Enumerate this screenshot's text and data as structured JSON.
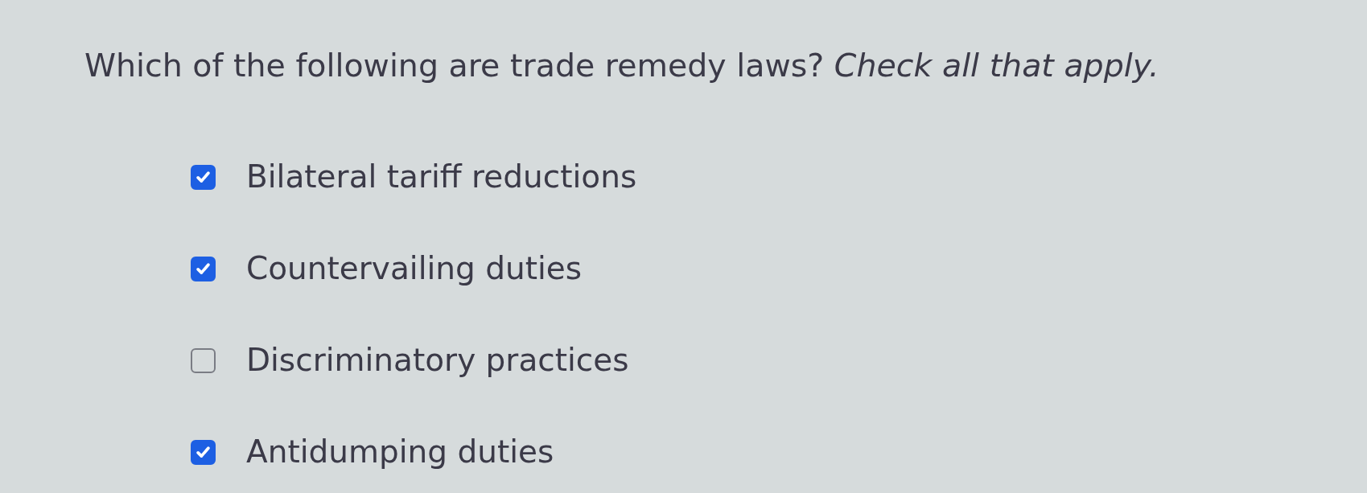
{
  "question": {
    "text": "Which of the following are trade remedy laws? *Check all that apply.*"
  },
  "options": [
    {
      "label": "Bilateral tariff reductions",
      "checked": true
    },
    {
      "label": "Countervailing duties",
      "checked": true
    },
    {
      "label": "Discriminatory practices",
      "checked": false
    },
    {
      "label": "Antidumping duties",
      "checked": true
    }
  ]
}
